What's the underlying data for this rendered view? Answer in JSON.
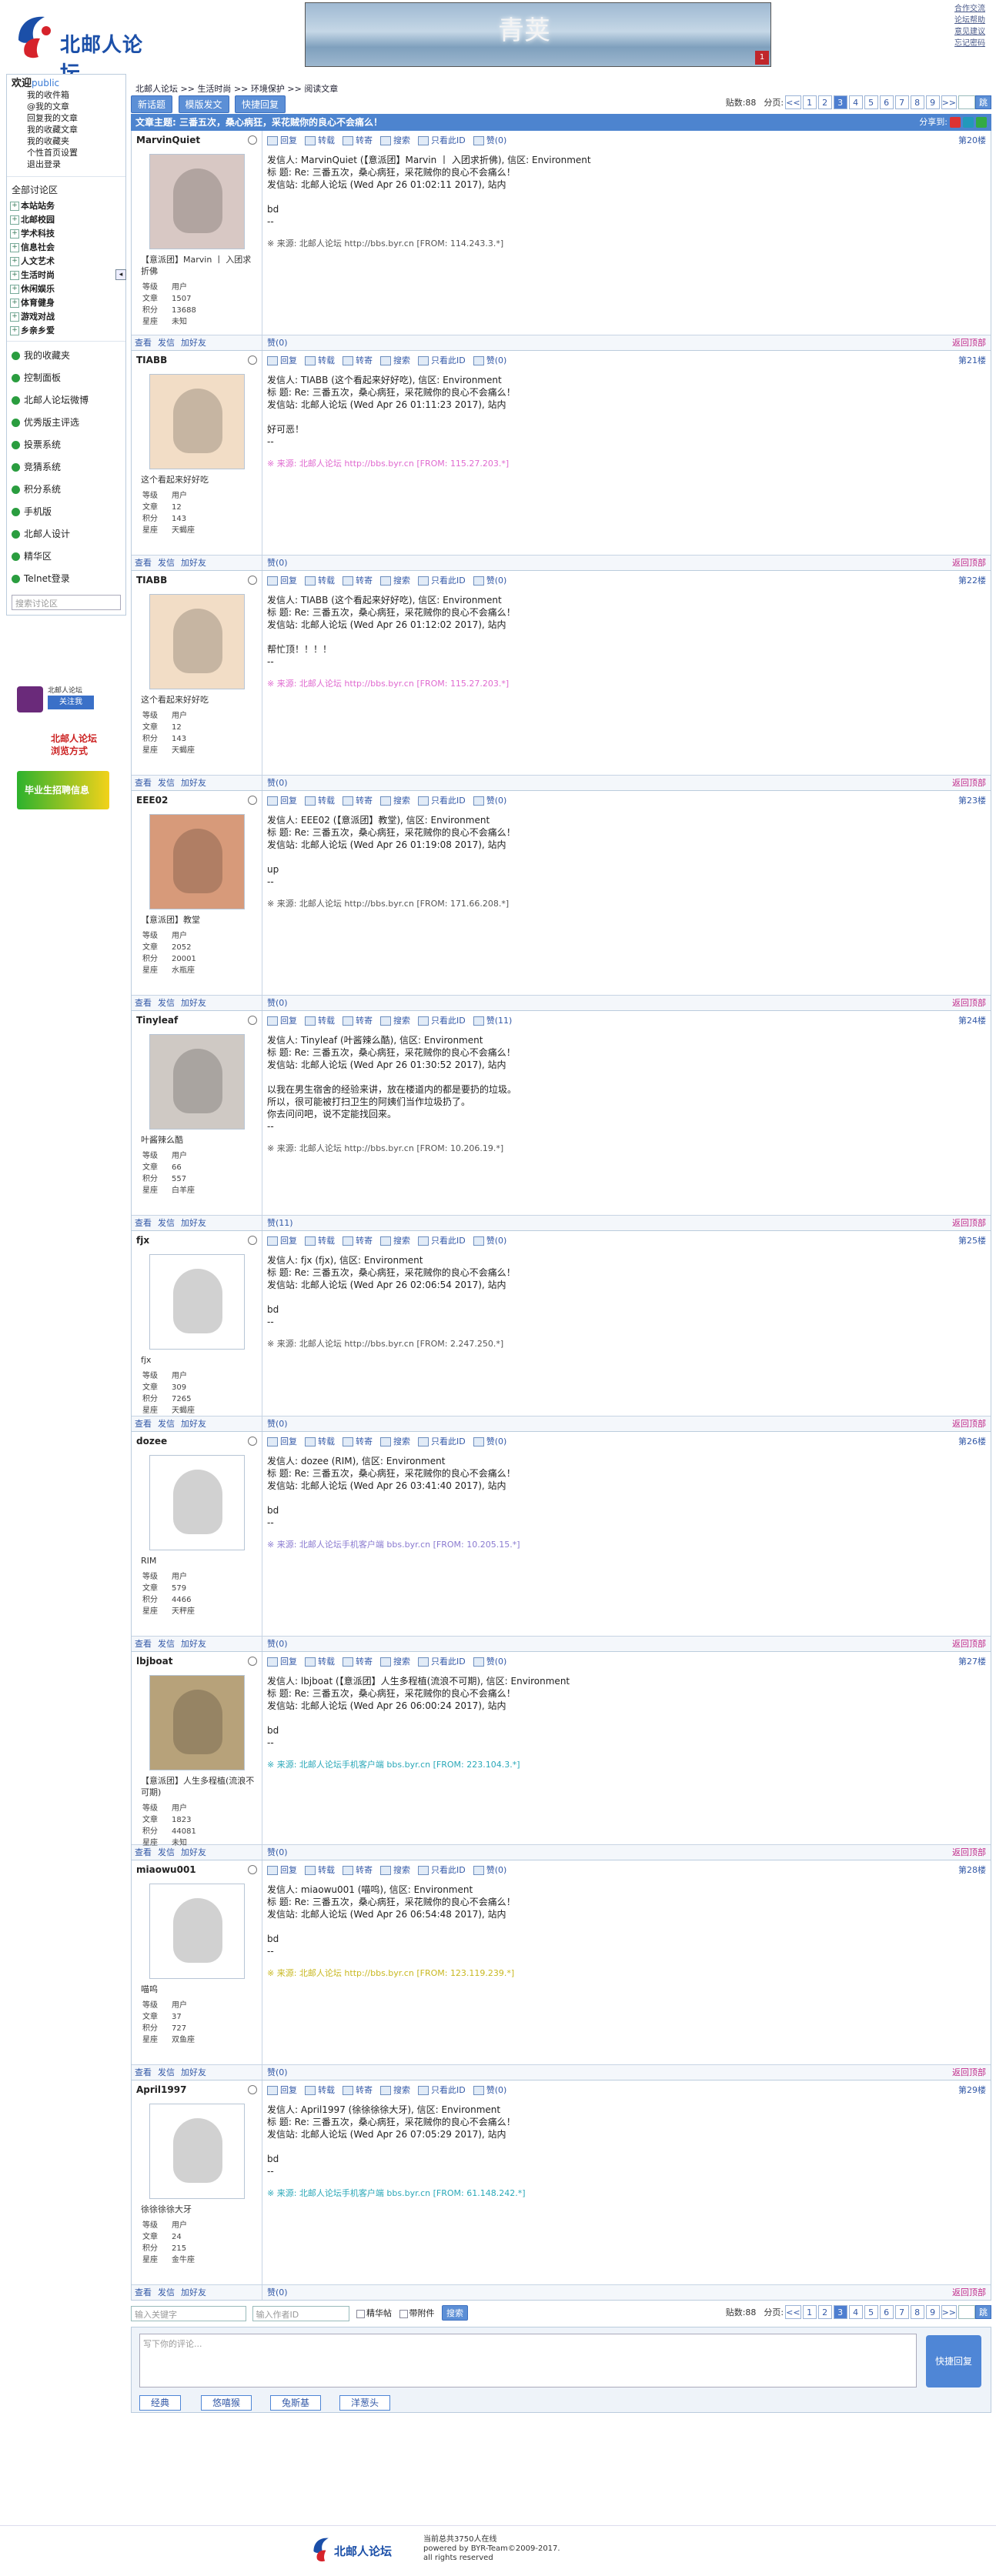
{
  "site": {
    "logo_text": "北邮人论坛",
    "banner_text": "青荚",
    "banner_badge": "1",
    "top_links": [
      "合作交流",
      "论坛帮助",
      "意见建议",
      "忘记密码"
    ]
  },
  "sidebar": {
    "welcome": "欢迎",
    "user": "public",
    "user_links": [
      "我的收件箱",
      "@我的文章",
      "回复我的文章",
      "我的收藏文章",
      "我的收藏夹",
      "个性首页设置",
      "退出登录"
    ],
    "all_boards": "全部讨论区",
    "boards": [
      "本站站务",
      "北邮校园",
      "学术科技",
      "信息社会",
      "人文艺术",
      "生活时尚",
      "休闲娱乐",
      "体育健身",
      "游戏对战",
      "乡亲乡爱"
    ],
    "entries": [
      "我的收藏夹",
      "控制面板",
      "北邮人论坛微博",
      "优秀版主评选",
      "投票系统",
      "竞猜系统",
      "积分系统",
      "手机版",
      "北邮人设计",
      "精华区",
      "Telnet登录"
    ],
    "search_placeholder": "搜索讨论区",
    "weibo_label": "北邮人论坛",
    "weibo_btn": "关注我",
    "promo1": "北邮人论坛 浏览方式",
    "promo2": "毕业生招聘信息"
  },
  "main": {
    "breadcrumb": [
      "北邮人论坛",
      ">>",
      "生活时尚",
      ">>",
      "环境保护",
      ">>",
      "阅读文章"
    ],
    "buttons": [
      "新话题",
      "模版发文",
      "快捷回复"
    ],
    "pager": {
      "count_label": "贴数:88",
      "pages_label": "分页:",
      "prev": "<<",
      "pages": [
        "1",
        "2",
        "3",
        "4",
        "5",
        "6",
        "7",
        "8",
        "9"
      ],
      "current": "3",
      "next": ">>",
      "go": "跳"
    },
    "title": "文章主题: 三番五次，桑心病狂，采花贼你的良心不会痛么！",
    "share_label": "分享到:",
    "tool_labels": [
      "回复",
      "转载",
      "转寄",
      "搜索",
      "只看此ID"
    ],
    "foot_labels": [
      "查看",
      "发信",
      "加好友"
    ],
    "back_top": "返回顶部",
    "stat_labels": [
      "等级",
      "文章",
      "积分",
      "星座"
    ]
  },
  "posts": [
    {
      "user": "MarvinQuiet",
      "floor": "第20楼",
      "like": "赞(0)",
      "nick": "【意派团】Marvin 丨 入团求折佛",
      "level": "用户",
      "articles": "1507",
      "points": "13688",
      "star": "未知",
      "header": "发信人: MarvinQuiet (【意派团】Marvin 丨 入团求折佛), 信区: Environment\n标  题: Re: 三番五次，桑心病狂，采花贼你的良心不会痛么！\n发信站: 北邮人论坛 (Wed Apr 26 01:02:11 2017), 站内",
      "content": "bd\n--",
      "src": "来源: 北邮人论坛 http://bbs.byr.cn [FROM: 114.243.3.*]",
      "src_color": "#555",
      "av": "#d8c8c4"
    },
    {
      "user": "TIABB",
      "floor": "第21楼",
      "like": "赞(0)",
      "nick": "这个看起来好好吃",
      "level": "用户",
      "articles": "12",
      "points": "143",
      "star": "天蝎座",
      "header": "发信人: TIABB (这个看起来好好吃), 信区: Environment\n标  题: Re: 三番五次，桑心病狂，采花贼你的良心不会痛么！\n发信站: 北邮人论坛 (Wed Apr 26 01:11:23 2017), 站内",
      "content": "好可恶！\n--",
      "src": "来源: 北邮人论坛 http://bbs.byr.cn [FROM: 115.27.203.*]",
      "src_color": "#e06ad0",
      "av": "#f2ddc6"
    },
    {
      "user": "TIABB",
      "floor": "第22楼",
      "like": "赞(0)",
      "nick": "这个看起来好好吃",
      "level": "用户",
      "articles": "12",
      "points": "143",
      "star": "天蝎座",
      "header": "发信人: TIABB (这个看起来好好吃), 信区: Environment\n标  题: Re: 三番五次，桑心病狂，采花贼你的良心不会痛么！\n发信站: 北邮人论坛 (Wed Apr 26 01:12:02 2017), 站内",
      "content": "帮忙顶！！！！\n--",
      "src": "来源: 北邮人论坛 http://bbs.byr.cn [FROM: 115.27.203.*]",
      "src_color": "#e06ad0",
      "av": "#f2ddc6"
    },
    {
      "user": "EEE02",
      "floor": "第23楼",
      "like": "赞(0)",
      "nick": "【意派团】教堂",
      "level": "用户",
      "articles": "2052",
      "points": "20001",
      "star": "水瓶座",
      "header": "发信人: EEE02 (【意派团】教堂), 信区: Environment\n标  题: Re: 三番五次，桑心病狂，采花贼你的良心不会痛么！\n发信站: 北邮人论坛 (Wed Apr 26 01:19:08 2017), 站内",
      "content": "up\n--",
      "src": "来源: 北邮人论坛 http://bbs.byr.cn [FROM: 171.66.208.*]",
      "src_color": "#555",
      "av": "#d79a7a"
    },
    {
      "user": "Tinyleaf",
      "floor": "第24楼",
      "like": "赞(11)",
      "nick": "叶酱辣么酷",
      "level": "用户",
      "articles": "66",
      "points": "557",
      "star": "白羊座",
      "header": "发信人: Tinyleaf (叶酱辣么酷), 信区: Environment\n标  题: Re: 三番五次，桑心病狂，采花贼你的良心不会痛么！\n发信站: 北邮人论坛 (Wed Apr 26 01:30:52 2017), 站内",
      "content": "以我在男生宿舍的经验来讲，放在楼道内的都是要扔的垃圾。\n所以，很可能被打扫卫生的阿姨们当作垃圾扔了。\n你去问问吧，说不定能找回来。\n--",
      "src": "来源: 北邮人论坛 http://bbs.byr.cn [FROM: 10.206.19.*]",
      "src_color": "#555",
      "av": "#cfc9c4"
    },
    {
      "user": "fjx",
      "floor": "第25楼",
      "like": "赞(0)",
      "nick": "fjx",
      "level": "用户",
      "articles": "309",
      "points": "7265",
      "star": "天蝎座",
      "header": "发信人: fjx (fjx), 信区: Environment\n标  题: Re: 三番五次，桑心病狂，采花贼你的良心不会痛么！\n发信站: 北邮人论坛 (Wed Apr 26 02:06:54 2017), 站内",
      "content": "bd\n--",
      "src": "来源: 北邮人论坛 http://bbs.byr.cn [FROM: 2.247.250.*]",
      "src_color": "#555",
      "av": "#ffffff"
    },
    {
      "user": "dozee",
      "floor": "第26楼",
      "like": "赞(0)",
      "nick": "RIM",
      "level": "用户",
      "articles": "579",
      "points": "4466",
      "star": "天秤座",
      "header": "发信人: dozee (RIM), 信区: Environment\n标  题: Re: 三番五次，桑心病狂，采花贼你的良心不会痛么！\n发信站: 北邮人论坛 (Wed Apr 26 03:41:40 2017), 站内",
      "content": "bd\n--",
      "src": "来源: 北邮人论坛手机客户端 bbs.byr.cn [FROM: 10.205.15.*]",
      "src_color": "#8a7ad0",
      "av": "#ffffff"
    },
    {
      "user": "lbjboat",
      "floor": "第27楼",
      "like": "赞(0)",
      "nick": "【意派团】人生多程植(流浪不可期)",
      "level": "用户",
      "articles": "1823",
      "points": "44081",
      "star": "未知",
      "header": "发信人: lbjboat (【意派团】人生多程植(流浪不可期), 信区: Environment\n标  题: Re: 三番五次，桑心病狂，采花贼你的良心不会痛么！\n发信站: 北邮人论坛 (Wed Apr 26 06:00:24 2017), 站内",
      "content": "bd\n--",
      "src": "来源: 北邮人论坛手机客户端 bbs.byr.cn [FROM: 223.104.3.*]",
      "src_color": "#2aa8b8",
      "av": "#b7a27a"
    },
    {
      "user": "miaowu001",
      "floor": "第28楼",
      "like": "赞(0)",
      "nick": "喵呜",
      "level": "用户",
      "articles": "37",
      "points": "727",
      "star": "双鱼座",
      "header": "发信人: miaowu001 (喵呜), 信区: Environment\n标  题: Re: 三番五次，桑心病狂，采花贼你的良心不会痛么！\n发信站: 北邮人论坛 (Wed Apr 26 06:54:48 2017), 站内",
      "content": "bd\n--",
      "src": "来源: 北邮人论坛 http://bbs.byr.cn [FROM: 123.119.239.*]",
      "src_color": "#c8b820",
      "av": "#ffffff"
    },
    {
      "user": "April1997",
      "floor": "第29楼",
      "like": "赞(0)",
      "nick": "徐徐徐徐大牙",
      "level": "用户",
      "articles": "24",
      "points": "215",
      "star": "金牛座",
      "header": "发信人: April1997 (徐徐徐徐大牙), 信区: Environment\n标  题: Re: 三番五次，桑心病狂，采花贼你的良心不会痛么！\n发信站: 北邮人论坛 (Wed Apr 26 07:05:29 2017), 站内",
      "content": "bd\n--",
      "src": "来源: 北邮人论坛手机客户端 bbs.byr.cn [FROM: 61.148.242.*]",
      "src_color": "#2aa8b8",
      "av": "#ffffff"
    }
  ],
  "bottom": {
    "keyword_placeholder": "输入关键字",
    "author_placeholder": "输入作者ID",
    "elite": "精华帖",
    "attach": "带附件",
    "search": "搜索",
    "comment_placeholder": "写下你的评论...",
    "quick_reply": "快捷回复",
    "tags": [
      "经典",
      "悠嘻猴",
      "兔斯基",
      "洋葱头"
    ]
  },
  "footer": {
    "online": "当前总共3750人在线",
    "powered": "powered by BYR-Team©2009-2017.",
    "rights": "all rights reserved"
  }
}
